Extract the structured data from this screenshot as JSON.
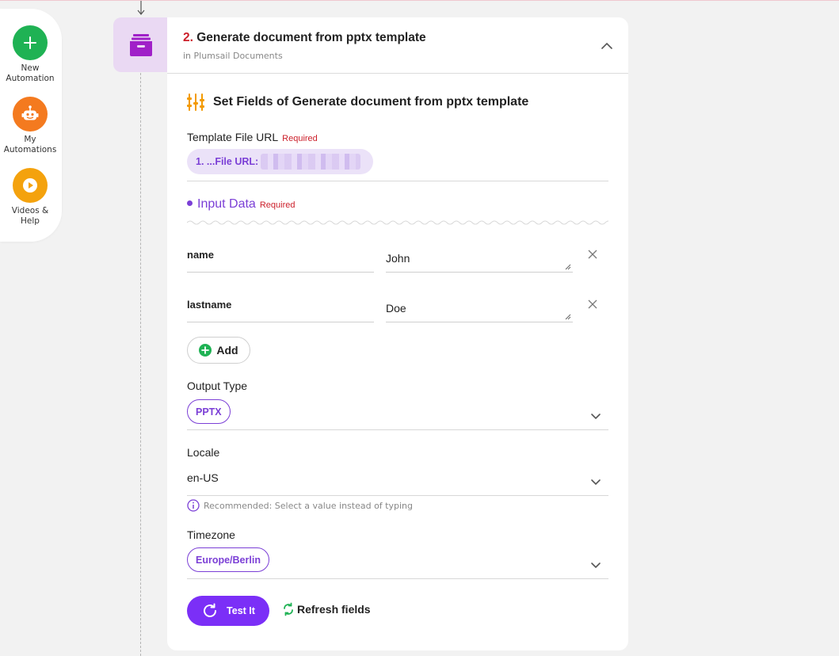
{
  "sidebar": {
    "items": [
      {
        "label_line1": "New",
        "label_line2": "Automation",
        "icon": "plus-icon",
        "color": "#1fb254"
      },
      {
        "label_line1": "My",
        "label_line2": "Automations",
        "icon": "robot-icon",
        "color": "#f47a1f"
      },
      {
        "label_line1": "Videos &",
        "label_line2": "Help",
        "icon": "play-icon",
        "color": "#f4a20d"
      }
    ]
  },
  "step": {
    "number": "2.",
    "title": "Generate document from pptx template",
    "subtitle": "in Plumsail Documents",
    "icon": "archive-box-icon",
    "icon_color": "#a020c8"
  },
  "fields_heading": "Set Fields of Generate document from pptx template",
  "required_label": "Required",
  "template_file": {
    "label": "Template File URL",
    "chip_text": "1. ...File URL:"
  },
  "input_data": {
    "label": "Input Data",
    "rows": [
      {
        "key": "name",
        "value": "John"
      },
      {
        "key": "lastname",
        "value": "Doe"
      }
    ],
    "add_label": "Add"
  },
  "output_type": {
    "label": "Output Type",
    "value": "PPTX"
  },
  "locale": {
    "label": "Locale",
    "value": "en-US",
    "hint": "Recommended: Select a value instead of typing"
  },
  "timezone": {
    "label": "Timezone",
    "value": "Europe/Berlin"
  },
  "actions": {
    "test_label": "Test It",
    "refresh_label": "Refresh fields"
  },
  "colors": {
    "accent": "#7b2ff7",
    "required": "#cc1f2a"
  }
}
